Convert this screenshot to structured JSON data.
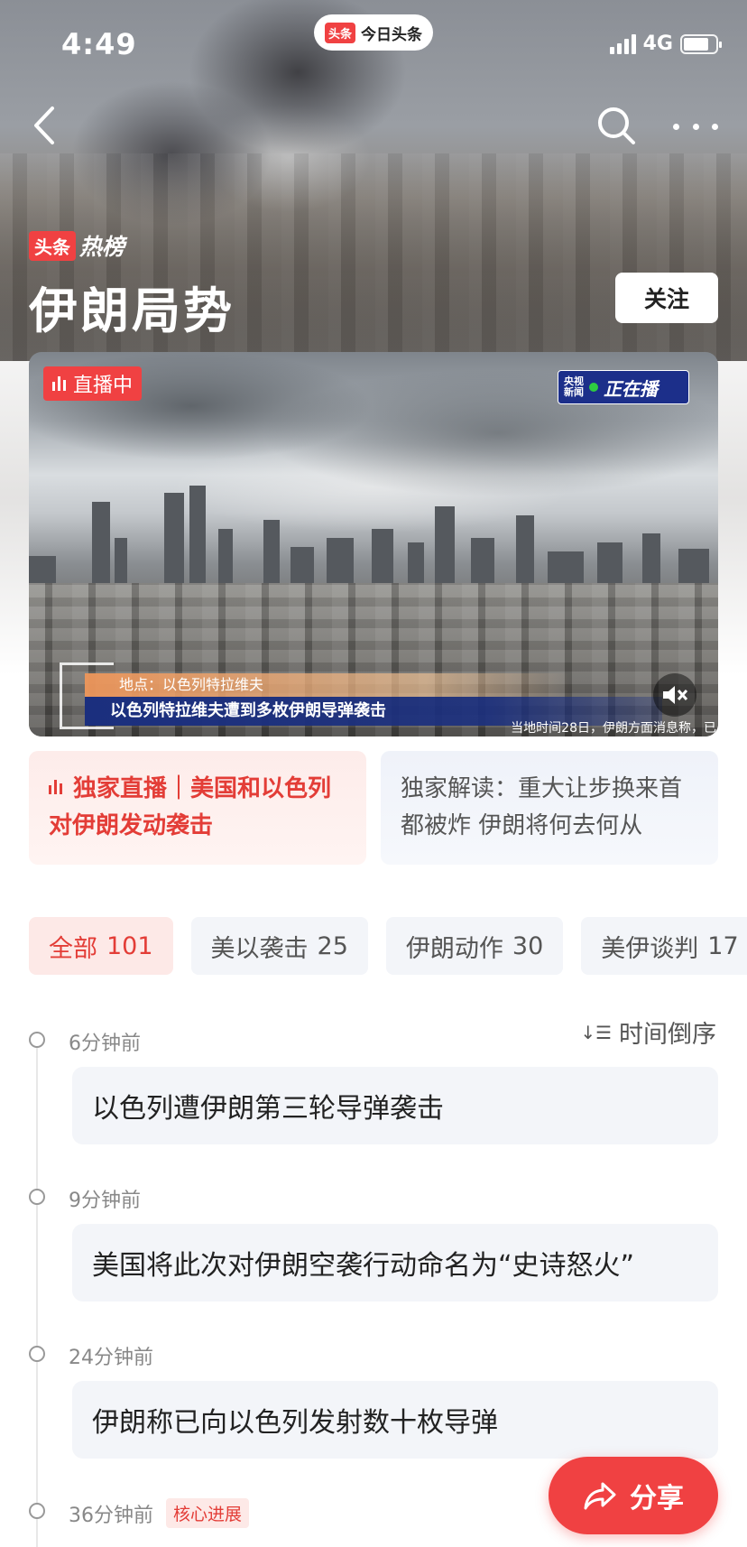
{
  "status_bar": {
    "time": "4:49",
    "app_pill_logo": "头条",
    "app_pill_text": "今日头条",
    "network": "4G"
  },
  "nav": {
    "back_icon": "back-arrow-icon",
    "search_icon": "search-icon",
    "more_icon": "more-dots-icon"
  },
  "header": {
    "brand_logo": "头条",
    "brand_text": "热榜",
    "title": "伊朗局势",
    "follow_label": "关注"
  },
  "video": {
    "live_label": "直播中",
    "cctv_small_line1": "央视",
    "cctv_small_line2": "新闻",
    "cctv_big": "正在播",
    "location_label": "地点：以色列特拉维夫",
    "headline": "以色列特拉维夫遭到多枚伊朗导弹袭击",
    "ticker": "当地时间28日，伊朗方面消息称，已",
    "mute_icon": "mute-icon"
  },
  "highlights": [
    {
      "text": "独家直播｜美国和以色列对伊朗发动袭击"
    },
    {
      "text": "独家解读：重大让步换来首都被炸 伊朗将何去何从"
    }
  ],
  "tabs": [
    {
      "label": "全部",
      "count": "101",
      "active": true
    },
    {
      "label": "美以袭击",
      "count": "25"
    },
    {
      "label": "伊朗动作",
      "count": "30"
    },
    {
      "label": "美伊谈判",
      "count": "17"
    }
  ],
  "sort": {
    "label": "时间倒序"
  },
  "timeline": [
    {
      "time": "6分钟前",
      "text": "以色列遭伊朗第三轮导弹袭击"
    },
    {
      "time": "9分钟前",
      "text": "美国将此次对伊朗空袭行动命名为“史诗怒火”"
    },
    {
      "time": "24分钟前",
      "text": "伊朗称已向以色列发射数十枚导弹"
    },
    {
      "time": "36分钟前",
      "tag": "核心进展"
    }
  ],
  "share": {
    "label": "分享"
  },
  "colors": {
    "accent": "#f04142",
    "card_bg": "#f3f5f9",
    "cctv_blue": "#1c2f8a"
  }
}
